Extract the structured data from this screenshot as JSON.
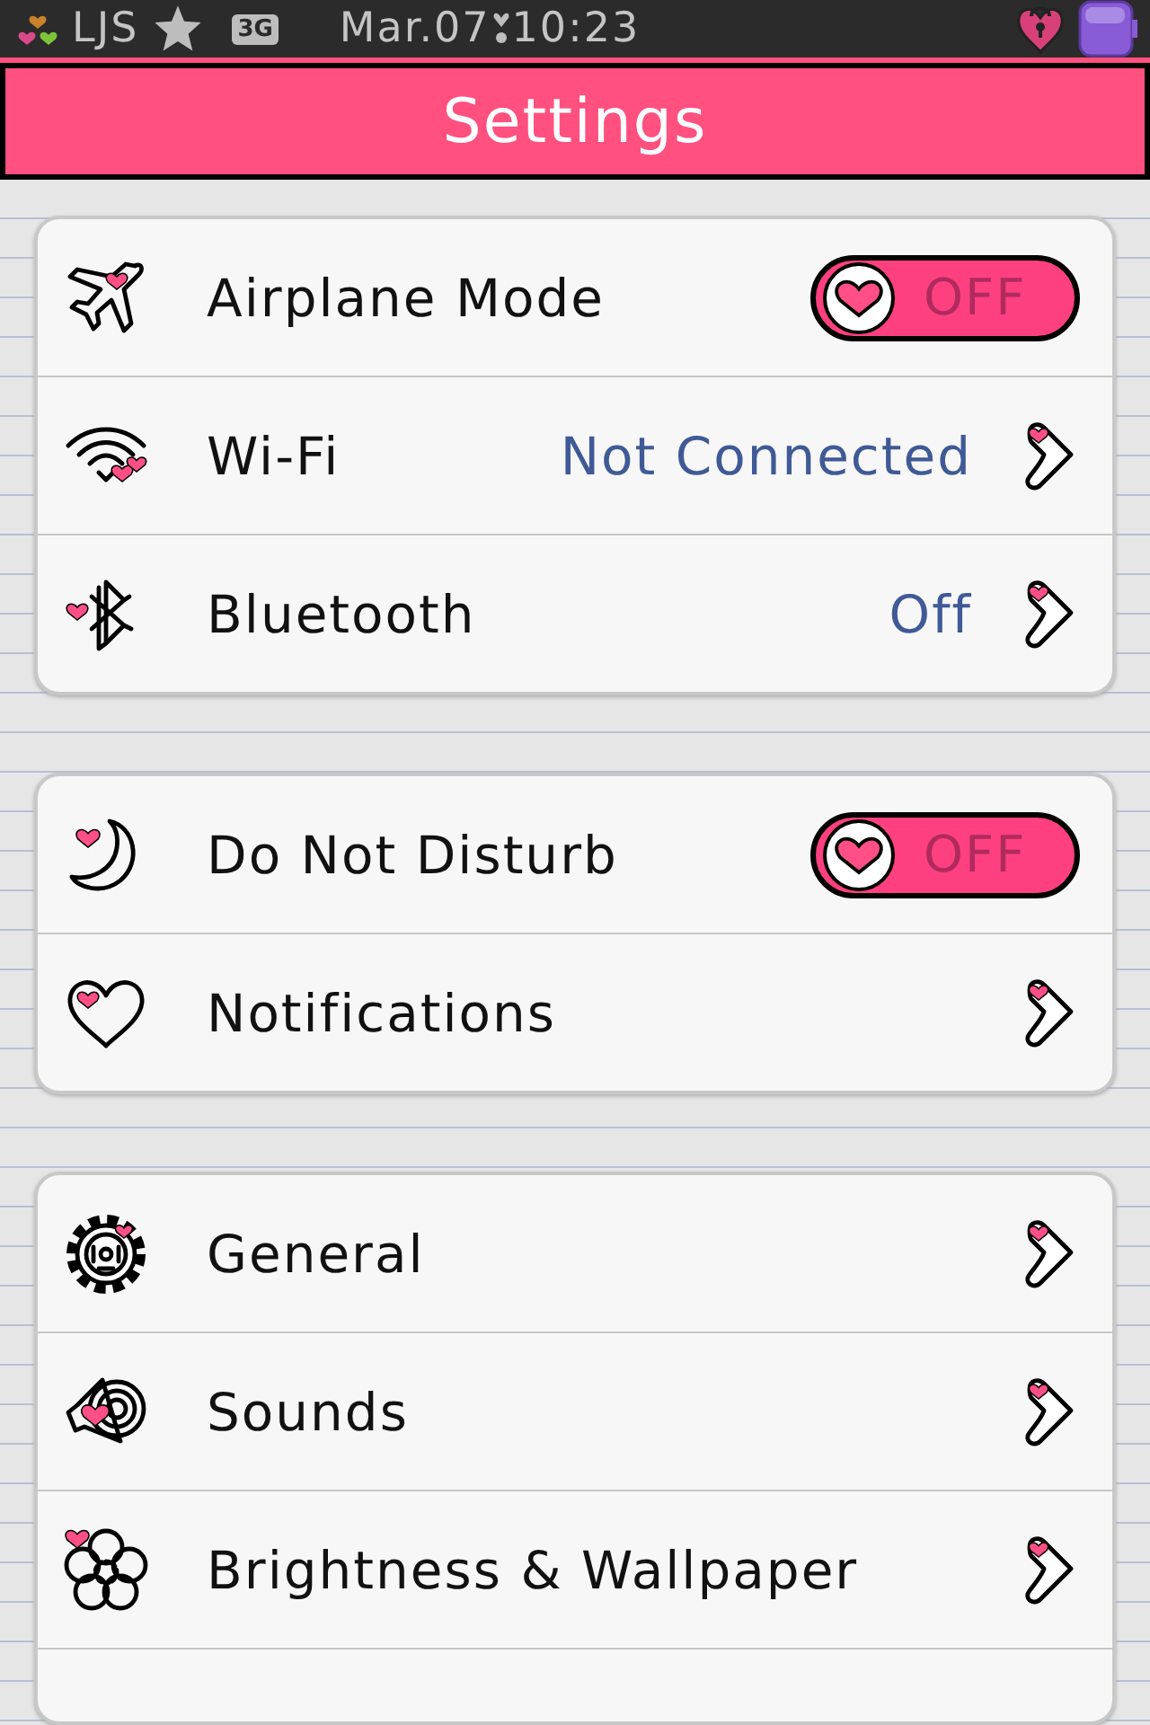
{
  "status_bar": {
    "carrier": "LJS",
    "network": "3G",
    "date": "Mar.07",
    "time": "10:23"
  },
  "header": {
    "title": "Settings"
  },
  "groups": [
    {
      "rows": [
        {
          "kind": "toggle",
          "label": "Airplane Mode",
          "on": false,
          "state_text": "OFF"
        },
        {
          "kind": "link",
          "label": "Wi-Fi",
          "value": "Not Connected"
        },
        {
          "kind": "link",
          "label": "Bluetooth",
          "value": "Off"
        }
      ]
    },
    {
      "rows": [
        {
          "kind": "toggle",
          "label": "Do Not Disturb",
          "on": false,
          "state_text": "OFF"
        },
        {
          "kind": "link",
          "label": "Notifications"
        }
      ]
    },
    {
      "rows": [
        {
          "kind": "link",
          "label": "General"
        },
        {
          "kind": "link",
          "label": "Sounds"
        },
        {
          "kind": "link",
          "label": "Brightness & Wallpaper"
        },
        {
          "kind": "blank"
        }
      ]
    }
  ]
}
